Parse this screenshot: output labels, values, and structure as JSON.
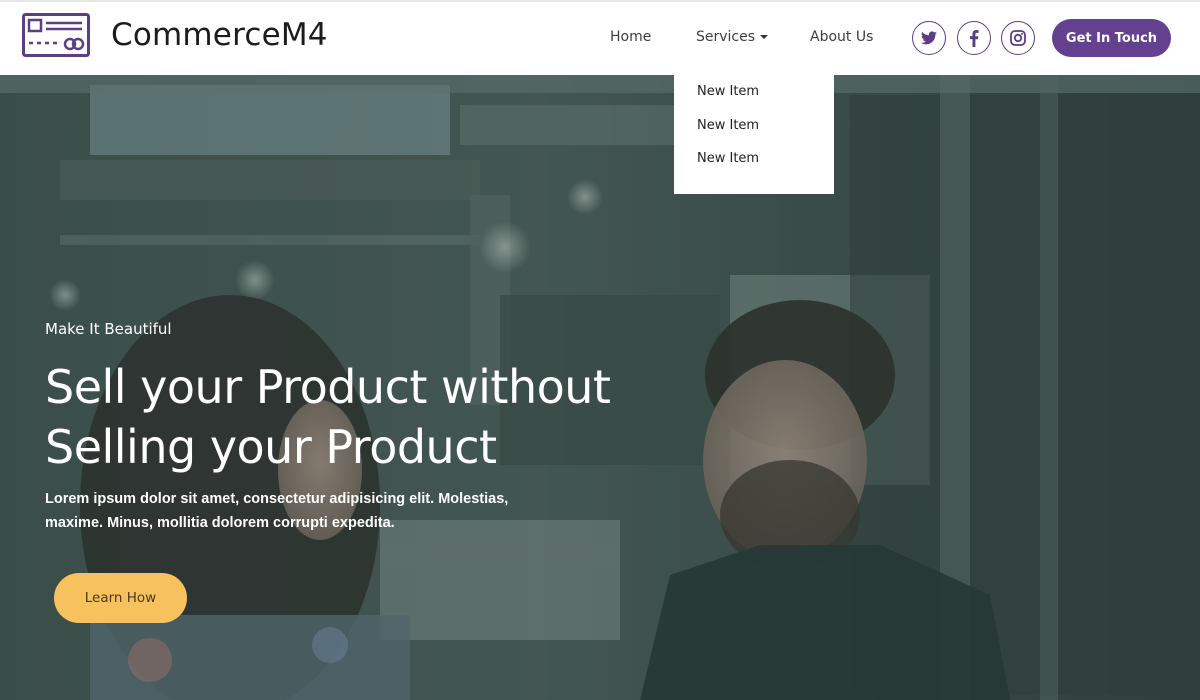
{
  "brand": {
    "name": "CommerceM4",
    "logo_icon": "credit-card-icon"
  },
  "nav": {
    "items": [
      {
        "label": "Home"
      },
      {
        "label": "Services",
        "has_dropdown": true
      },
      {
        "label": "About Us"
      }
    ],
    "dropdown_items": [
      {
        "label": "New Item"
      },
      {
        "label": "New Item"
      },
      {
        "label": "New Item"
      }
    ]
  },
  "social": [
    {
      "icon": "twitter-icon"
    },
    {
      "icon": "facebook-icon"
    },
    {
      "icon": "instagram-icon"
    }
  ],
  "cta": {
    "label": "Get In Touch"
  },
  "hero": {
    "eyebrow": "Make It Beautiful",
    "title_line1": "Sell your Product without",
    "title_line2": "Selling your Product",
    "description_line1": "Lorem ipsum dolor sit amet, consectetur adipisicing elit. Molestias,",
    "description_line2": "maxime. Minus, mollitia dolorem corrupti expedita.",
    "button_label": "Learn How"
  },
  "colors": {
    "primary": "#64418e",
    "accent": "#f7c25d",
    "overlay": "#2e3f3d"
  }
}
